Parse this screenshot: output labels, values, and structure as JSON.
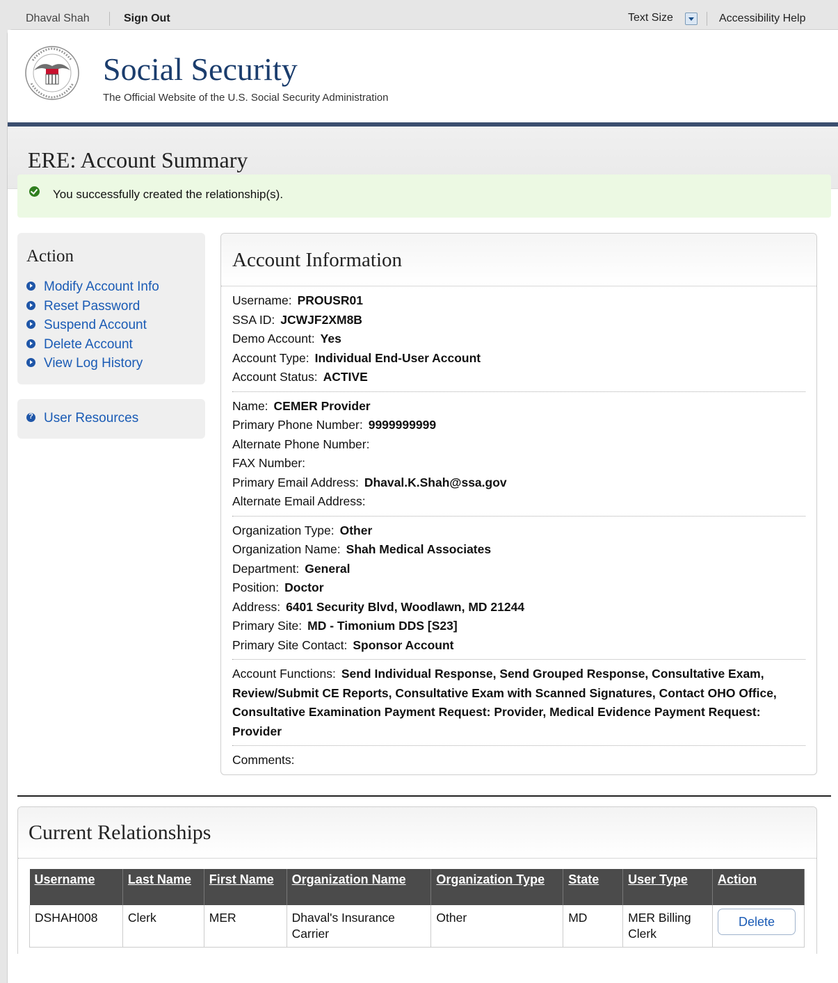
{
  "topbar": {
    "user_name": "Dhaval Shah",
    "sign_out": "Sign Out",
    "text_size": "Text Size",
    "accessibility_help": "Accessibility Help"
  },
  "brand": {
    "title": "Social Security",
    "subtitle": "The Official Website of the U.S. Social Security Administration"
  },
  "page_title": "ERE: Account Summary",
  "alert": {
    "message": "You successfully created the relationship(s).",
    "color": "#ecf9e3"
  },
  "sidebar": {
    "action_title": "Action",
    "actions": [
      {
        "label": "Modify Account Info"
      },
      {
        "label": "Reset Password"
      },
      {
        "label": "Suspend Account"
      },
      {
        "label": "Delete Account"
      },
      {
        "label": "View Log History"
      }
    ],
    "resources_label": "User Resources"
  },
  "account": {
    "title": "Account Information",
    "sections": [
      [
        {
          "label": "Username:",
          "value": "PROUSR01"
        },
        {
          "label": "SSA ID:",
          "value": "JCWJF2XM8B"
        },
        {
          "label": "Demo Account:",
          "value": "Yes"
        },
        {
          "label": "Account Type:",
          "value": "Individual End-User Account"
        },
        {
          "label": "Account Status:",
          "value": "ACTIVE"
        }
      ],
      [
        {
          "label": "Name:",
          "value": "CEMER Provider"
        },
        {
          "label": "Primary Phone Number:",
          "value": "9999999999"
        },
        {
          "label": "Alternate Phone Number:",
          "value": ""
        },
        {
          "label": "FAX Number:",
          "value": ""
        },
        {
          "label": "Primary Email Address:",
          "value": "Dhaval.K.Shah@ssa.gov"
        },
        {
          "label": "Alternate Email Address:",
          "value": ""
        }
      ],
      [
        {
          "label": "Organization Type:",
          "value": "Other"
        },
        {
          "label": "Organization Name:",
          "value": "Shah Medical Associates"
        },
        {
          "label": "Department:",
          "value": "General"
        },
        {
          "label": "Position:",
          "value": "Doctor"
        },
        {
          "label": "Address:",
          "value": "6401 Security Blvd, Woodlawn, MD 21244"
        },
        {
          "label": "Primary Site:",
          "value": "MD - Timonium DDS [S23]"
        },
        {
          "label": "Primary Site Contact:",
          "value": "Sponsor Account"
        }
      ],
      [
        {
          "label": "Account Functions:",
          "value": "Send Individual Response, Send Grouped Response, Consultative Exam, Review/Submit CE Reports, Consultative Exam with Scanned Signatures, Contact OHO Office, Consultative Examination Payment Request: Provider, Medical Evidence Payment Request: Provider"
        }
      ],
      [
        {
          "label": "Comments:",
          "value": ""
        }
      ]
    ]
  },
  "relationships": {
    "title": "Current Relationships",
    "headers": [
      "Username",
      "Last Name",
      "First Name",
      "Organization Name",
      "Organization Type",
      "State",
      "User Type",
      "Action"
    ],
    "rows": [
      [
        "DSHAH008",
        "Clerk",
        "MER",
        "Dhaval's Insurance Carrier",
        "Other",
        "MD",
        "MER Billing Clerk",
        "Delete"
      ]
    ]
  },
  "colors": {
    "brand_blue": "#1b3d6d",
    "header_bar": "#3b4e6f",
    "link": "#1a5bb5",
    "table_header": "#4b4b4b"
  }
}
